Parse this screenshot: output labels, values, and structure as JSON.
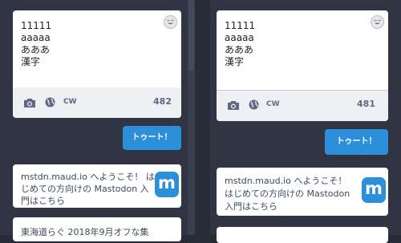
{
  "columns": [
    {
      "compose": {
        "lines": "11111\naaaaa\nあああ\n漢字",
        "cw_label": "CW",
        "counter": "482"
      },
      "toot_label": "トゥート！",
      "welcome_card": {
        "lines": [
          "mstdn.maud.io へようこそ！ は",
          "じめての方向けの Mastodon 入",
          "門はこちら"
        ]
      },
      "next_card": {
        "line": "東海道らぐ 2018年9月オフな集"
      }
    },
    {
      "compose": {
        "lines": "11111\naaaaa\nあああ\n漢字",
        "cw_label": "CW",
        "counter": "481"
      },
      "toot_label": "トゥート！",
      "welcome_card": {
        "lines": [
          "mstdn.maud.io へようこそ！",
          "はじめての方向けの Mastodon",
          "入門はこちら"
        ]
      }
    }
  ],
  "colors": {
    "background": "#282c37",
    "column": "#313543",
    "accent": "#2b90d9",
    "icon": "#606984"
  },
  "icons": [
    "camera-icon",
    "globe-icon",
    "emoji-icon",
    "mastodon-logo"
  ]
}
